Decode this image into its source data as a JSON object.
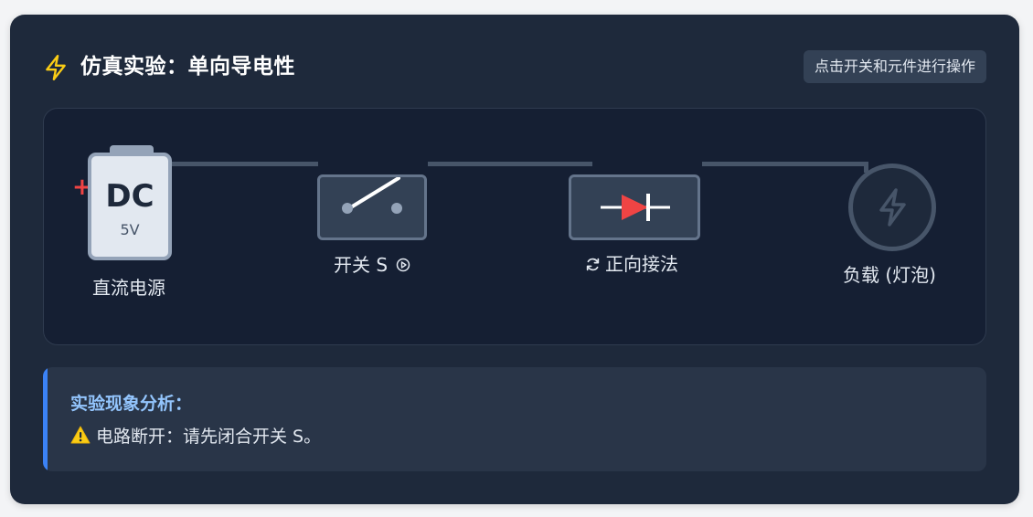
{
  "header": {
    "title": "仿真实验：单向导电性",
    "hint": "点击开关和元件进行操作",
    "icon": "lightning-icon"
  },
  "circuit": {
    "battery": {
      "plus": "+",
      "type": "DC",
      "voltage": "5V",
      "label": "直流电源"
    },
    "switch": {
      "label": "开关 S",
      "state": "open",
      "icon": "play-circle-icon"
    },
    "diode": {
      "label": "正向接法",
      "icon": "refresh-icon",
      "orientation": "forward"
    },
    "load": {
      "label": "负载 (灯泡)",
      "icon": "lightning-icon",
      "state": "off"
    }
  },
  "analysis": {
    "title": "实验现象分析：",
    "status_icon": "⚠️",
    "message": "电路断开：请先闭合开关 S。"
  },
  "colors": {
    "panel_bg": "#1e293b",
    "accent_blue": "#3b82f6",
    "diode_red": "#ef4444",
    "lightning_yellow": "#facc15"
  }
}
